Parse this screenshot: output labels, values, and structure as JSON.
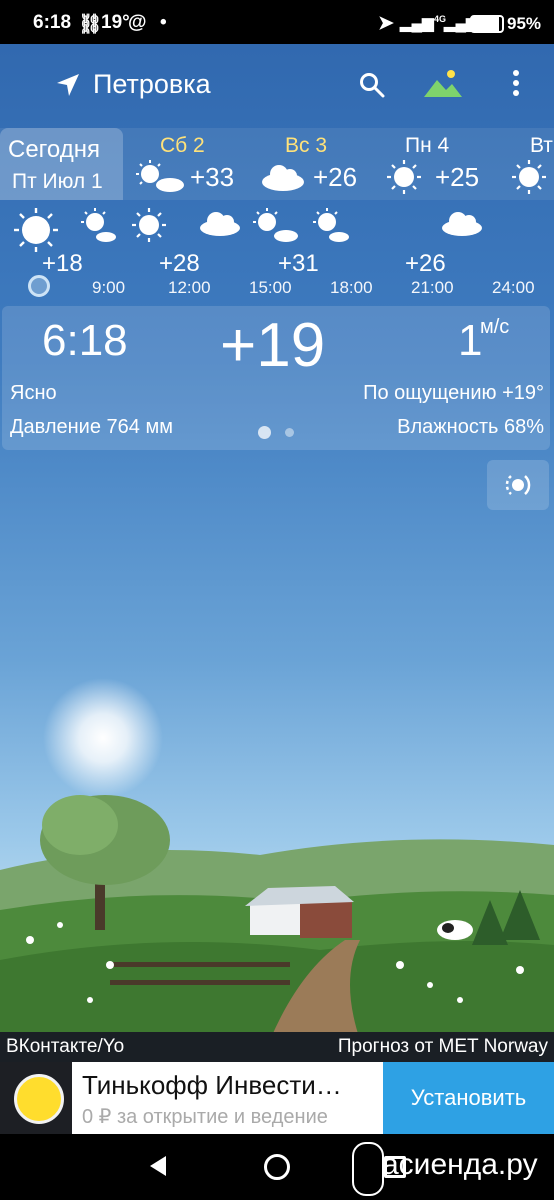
{
  "status": {
    "time": "6:18",
    "temp": "19°",
    "battery": "95%",
    "net": "4G"
  },
  "header": {
    "location": "Петровка"
  },
  "days": [
    {
      "name": "Сегодня",
      "sub": "Пт Июл 1"
    },
    {
      "name": "Сб 2",
      "temp": "+33",
      "icon": "sun-cloud-icon"
    },
    {
      "name": "Вс 3",
      "temp": "+26",
      "icon": "cloud-icon"
    },
    {
      "name": "Пн 4",
      "temp": "+25",
      "icon": "sun-icon"
    },
    {
      "name": "Вт",
      "icon": "sun-icon"
    }
  ],
  "hourly": {
    "temps": [
      "+18",
      "+28",
      "+31",
      "+26"
    ],
    "times": [
      "9:00",
      "12:00",
      "15:00",
      "18:00",
      "21:00",
      "24:00"
    ]
  },
  "current": {
    "time": "6:18",
    "temp": "+19",
    "wind": "1",
    "wind_unit": "м/с",
    "condition": "Ясно",
    "feels_like": "По ощущению +19°",
    "pressure": "Давление 764 мм",
    "humidity": "Влажность 68%"
  },
  "source": {
    "left": "ВКонтакте/Yo",
    "right": "Прогноз от MET Norway"
  },
  "ad": {
    "title": "Тинькофф Инвести…",
    "subtitle": "0 ₽ за открытие и ведение",
    "button": "Установить"
  },
  "watermark": "асиенда.ру",
  "colors": {
    "accent": "#2ea1e4",
    "day_label": "#ffe27a"
  }
}
